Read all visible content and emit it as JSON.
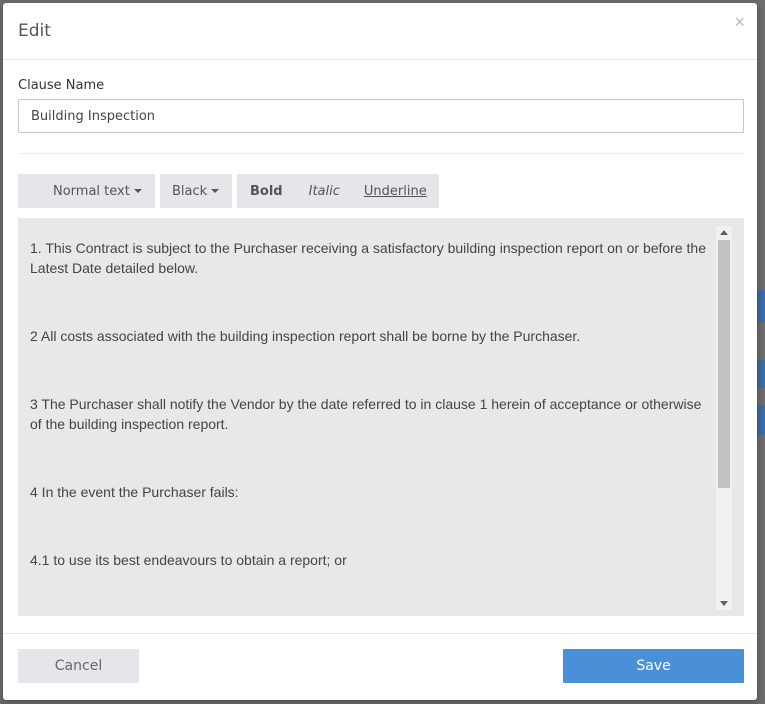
{
  "modal": {
    "title": "Edit",
    "close_glyph": "×",
    "close_icon": "close-icon"
  },
  "clause": {
    "label": "Clause Name",
    "value": "Building Inspection"
  },
  "toolbar": {
    "style_label": "Normal text",
    "color_label": "Black",
    "bold_label": "Bold",
    "italic_label": "Italic",
    "underline_label": "Underline",
    "caret_icon": "caret-down-icon"
  },
  "editor": {
    "paragraphs": [
      "1. This Contract is subject to the Purchaser receiving a satisfactory building inspection report on or before the Latest Date detailed below.",
      "2 All costs associated with the building inspection report shall be borne by the Purchaser.",
      "3 The Purchaser shall notify the Vendor by the date referred to in clause 1 herein of acceptance or otherwise of the building inspection report.",
      "4 In the event the Purchaser fails:",
      "4.1  to use its best endeavours to obtain a report; or"
    ]
  },
  "footer": {
    "cancel_label": "Cancel",
    "save_label": "Save"
  },
  "colors": {
    "primary": "#4a90d9",
    "toolbar_bg": "#e4e6ea",
    "editor_bg": "#e8e8e8"
  }
}
